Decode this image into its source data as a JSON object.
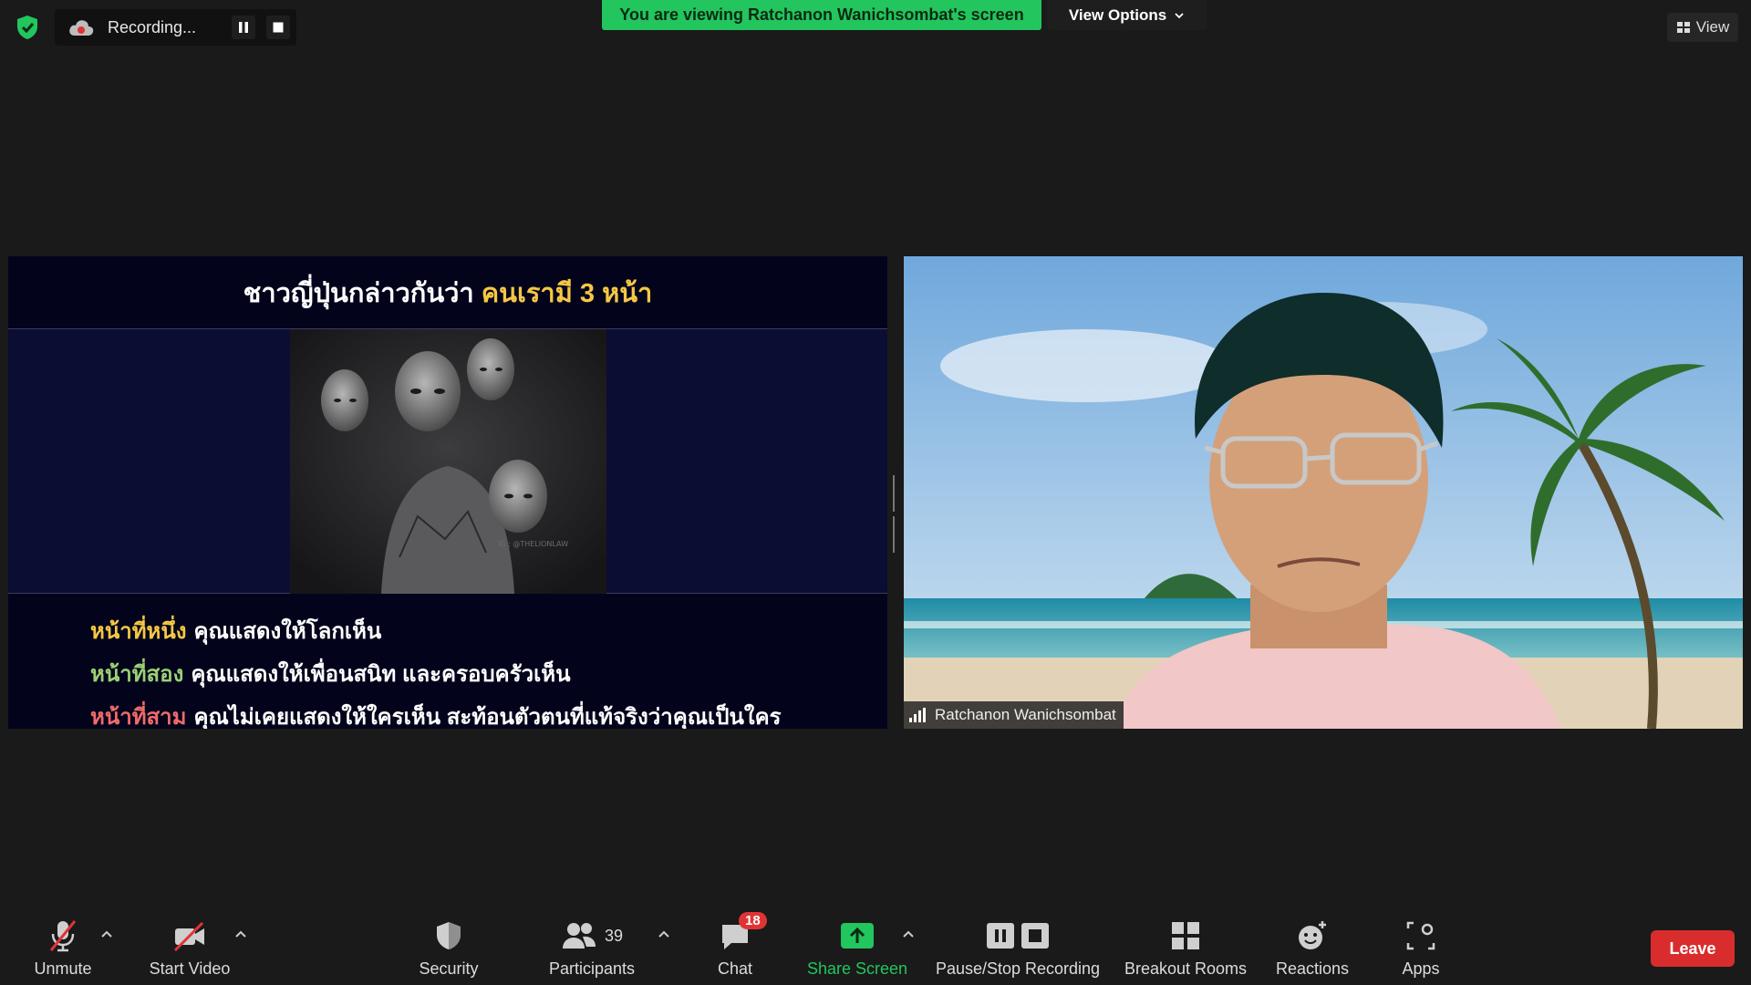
{
  "recording": {
    "status": "Recording..."
  },
  "banner": {
    "text": "You are viewing Ratchanon Wanichsombat's screen"
  },
  "view_options": {
    "label": "View Options"
  },
  "view": {
    "label": "View"
  },
  "slide": {
    "title": "ชาวญี่ปุ่นกล่าวกันว่า",
    "title_highlight": "คนเรามี 3 หน้า",
    "image_watermark": "IG : @THELIONLAW",
    "lines": [
      {
        "key": "หน้าที่หนึ่ง",
        "text": "คุณแสดงให้โลกเห็น"
      },
      {
        "key": "หน้าที่สอง",
        "text": "คุณแสดงให้เพื่อนสนิท และครอบครัวเห็น"
      },
      {
        "key": "หน้าที่สาม",
        "text": "คุณไม่เคยแสดงให้ใครเห็น สะท้อนตัวตนที่แท้จริงว่าคุณเป็นใคร"
      }
    ]
  },
  "participant": {
    "name": "Ratchanon Wanichsombat"
  },
  "toolbar": {
    "unmute": "Unmute",
    "start_video": "Start Video",
    "security": "Security",
    "participants": "Participants",
    "participants_count": "39",
    "chat": "Chat",
    "chat_badge": "18",
    "share_screen": "Share Screen",
    "pause_stop_recording": "Pause/Stop Recording",
    "breakout_rooms": "Breakout Rooms",
    "reactions": "Reactions",
    "apps": "Apps",
    "leave": "Leave"
  },
  "colors": {
    "banner_green": "#22c55e",
    "share_green": "#22c55e",
    "leave_red": "#d92d2d",
    "badge_red": "#e03434",
    "slide_highlight": "#f6c744",
    "line1": "#f6c744",
    "line2": "#9bd074",
    "line3": "#f06a6a"
  }
}
